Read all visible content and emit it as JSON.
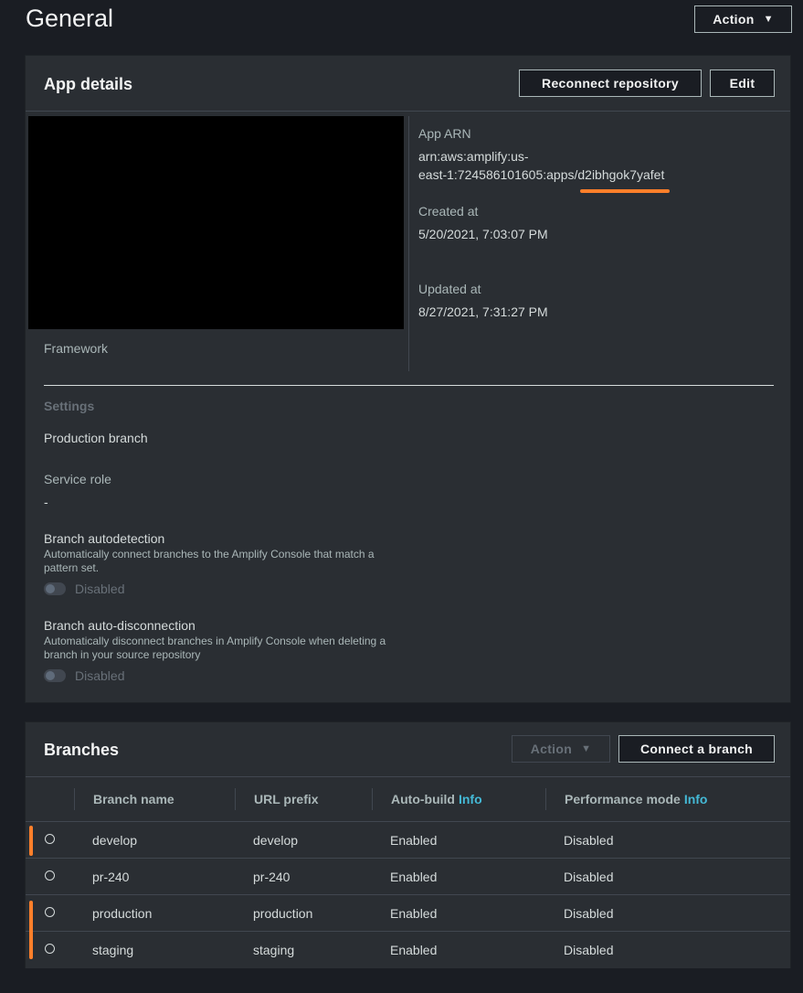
{
  "page": {
    "title": "General",
    "action_label": "Action"
  },
  "app_details": {
    "title": "App details",
    "reconnect_label": "Reconnect repository",
    "edit_label": "Edit",
    "framework_label": "Framework",
    "app_arn_label": "App ARN",
    "app_arn_line1": "arn:aws:amplify:us-",
    "app_arn_line2": "east-1:724586101605:apps/d2ibhgok7yafet",
    "created_label": "Created at",
    "created_value": "5/20/2021, 7:03:07 PM",
    "updated_label": "Updated at",
    "updated_value": "8/27/2021, 7:31:27 PM",
    "settings_heading": "Settings",
    "production_branch_label": "Production branch",
    "service_role_label": "Service role",
    "service_role_value": "-",
    "autodetect_title": "Branch autodetection",
    "autodetect_desc": "Automatically connect branches to the Amplify Console that match a pattern set.",
    "autodetect_state": "Disabled",
    "autodisconnect_title": "Branch auto-disconnection",
    "autodisconnect_desc": "Automatically disconnect branches in Amplify Console when deleting a branch in your source repository",
    "autodisconnect_state": "Disabled"
  },
  "branches": {
    "title": "Branches",
    "action_label": "Action",
    "connect_label": "Connect a branch",
    "columns": {
      "name": "Branch name",
      "url_prefix": "URL prefix",
      "auto_build": "Auto-build",
      "performance": "Performance mode",
      "info": "Info"
    },
    "rows": [
      {
        "name": "develop",
        "url_prefix": "develop",
        "auto_build": "Enabled",
        "performance": "Disabled"
      },
      {
        "name": "pr-240",
        "url_prefix": "pr-240",
        "auto_build": "Enabled",
        "performance": "Disabled"
      },
      {
        "name": "production",
        "url_prefix": "production",
        "auto_build": "Enabled",
        "performance": "Disabled"
      },
      {
        "name": "staging",
        "url_prefix": "staging",
        "auto_build": "Enabled",
        "performance": "Disabled"
      }
    ]
  },
  "colors": {
    "accent": "#ff7f2a",
    "info_link": "#44b9d6",
    "panel": "#2a2e33",
    "background": "#1a1d23"
  }
}
